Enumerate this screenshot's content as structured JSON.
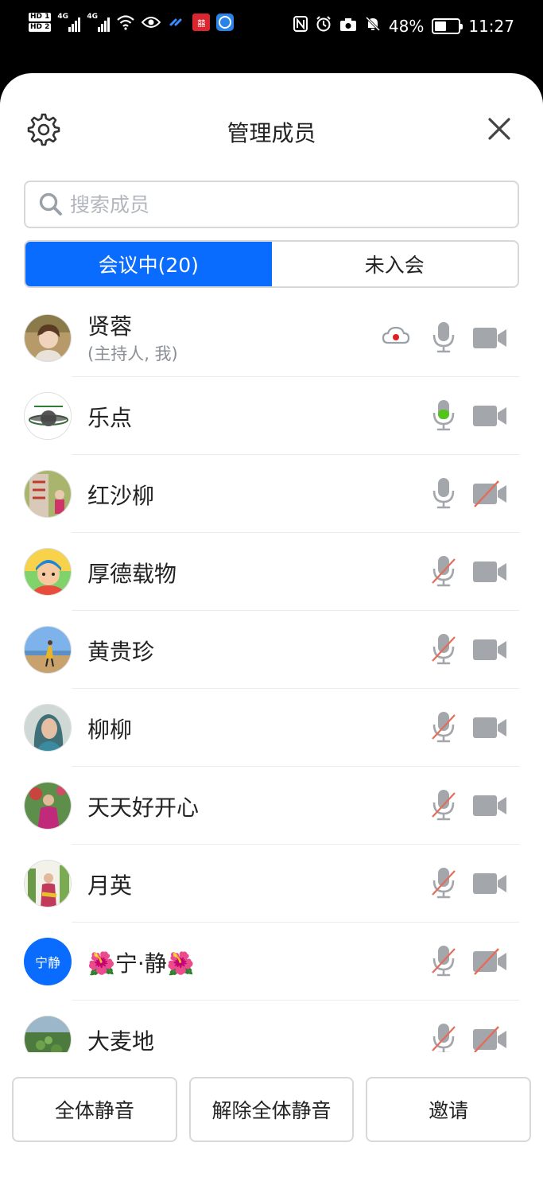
{
  "status_bar": {
    "hd1": "HD 1",
    "hd2": "HD 2",
    "net1": "4G",
    "net2": "4G",
    "battery_percent": "48%",
    "battery_level": 0.48,
    "time": "11:27",
    "icons": [
      "wifi-icon",
      "eye-icon",
      "link-icon",
      "app-icon",
      "browser-icon",
      "nfc-icon",
      "alarm-icon",
      "camera-icon",
      "mute-icon"
    ]
  },
  "header": {
    "title": "管理成员"
  },
  "search": {
    "placeholder": "搜索成员"
  },
  "tabs": [
    {
      "label": "会议中(20)",
      "active": true
    },
    {
      "label": "未入会",
      "active": false
    }
  ],
  "members": [
    {
      "name": "贤蓉",
      "sub": "(主持人, 我)",
      "recording": true,
      "mic": "on",
      "camera": "on"
    },
    {
      "name": "乐点",
      "mic": "active",
      "camera": "on"
    },
    {
      "name": "红沙柳",
      "mic": "on",
      "camera": "off"
    },
    {
      "name": "厚德载物",
      "mic": "off",
      "camera": "on"
    },
    {
      "name": "黄贵珍",
      "mic": "off",
      "camera": "on"
    },
    {
      "name": "柳柳",
      "mic": "off",
      "camera": "on"
    },
    {
      "name": "天天好开心",
      "mic": "off",
      "camera": "on"
    },
    {
      "name": "月英",
      "mic": "off",
      "camera": "on"
    },
    {
      "name": "🌺宁·静🌺",
      "avatar_text": "宁静",
      "mic": "off",
      "camera": "off"
    },
    {
      "name": "大麦地",
      "mic": "off",
      "camera": "off"
    }
  ],
  "buttons": {
    "mute_all": "全体静音",
    "unmute_all": "解除全体静音",
    "invite": "邀请"
  },
  "colors": {
    "accent": "#0a6cff",
    "icon_gray": "#a3a6ab",
    "mic_active": "#52c41a",
    "off_slash": "#e36d5b",
    "record_dot": "#e02020"
  }
}
